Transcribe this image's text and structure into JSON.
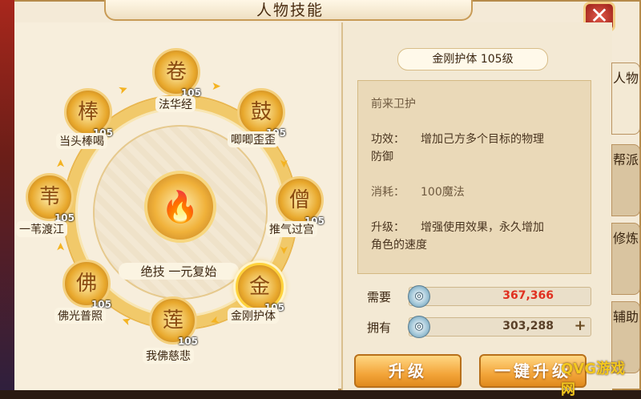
{
  "window": {
    "title": "人物技能",
    "close_glyph": "✕"
  },
  "center_skill": {
    "label": "绝技  一元复始",
    "icon": "flame-icon"
  },
  "skills": [
    {
      "name": "法华经",
      "level": "105",
      "icon": "scroll-icon"
    },
    {
      "name": "唧唧歪歪",
      "level": "105",
      "icon": "drum-icon"
    },
    {
      "name": "推气过宫",
      "level": "105",
      "icon": "monk-icon"
    },
    {
      "name": "金刚护体",
      "level": "105",
      "icon": "guardian-icon",
      "selected": true
    },
    {
      "name": "我佛慈悲",
      "level": "105",
      "icon": "lotus-icon"
    },
    {
      "name": "佛光普照",
      "level": "105",
      "icon": "temple-icon"
    },
    {
      "name": "一苇渡江",
      "level": "105",
      "icon": "reed-icon"
    },
    {
      "name": "当头棒喝",
      "level": "105",
      "icon": "staff-icon"
    }
  ],
  "detail": {
    "title": "金刚护体  105级",
    "subtitle": "前来卫护",
    "effect_label": "功效：",
    "effect_line1": "增加己方多个目标的物理",
    "effect_line2": "防御",
    "cost_label": "消耗：",
    "cost_value": "100魔法",
    "upgrade_label": "升级：",
    "upgrade_line1": "增强使用效果，永久增加",
    "upgrade_line2": "角色的速度"
  },
  "resources": {
    "need_label": "需要",
    "need_value": "367,366",
    "need_color": "#e03020",
    "have_label": "拥有",
    "have_value": "303,288",
    "have_color": "#5a4028",
    "add_glyph": "+"
  },
  "buttons": {
    "upgrade": "升级",
    "one_click": "一键升级"
  },
  "tabs": [
    {
      "label": "人物",
      "active": true
    },
    {
      "label": "帮派",
      "active": false
    },
    {
      "label": "修炼",
      "active": false
    },
    {
      "label": "辅助",
      "active": false
    }
  ],
  "watermark": {
    "text": "QVG游戏网"
  }
}
